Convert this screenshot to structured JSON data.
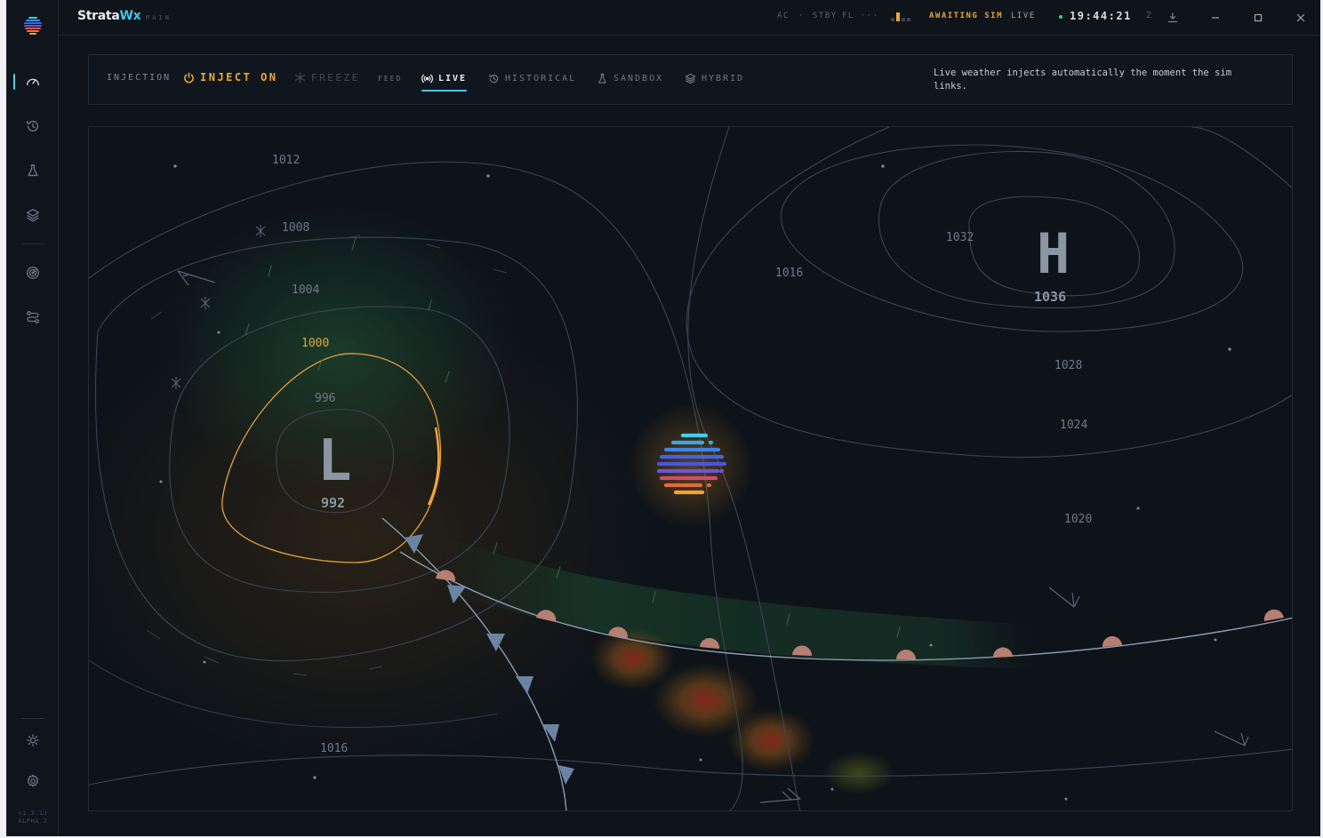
{
  "app": {
    "brand_main": "Strata",
    "brand_accent": "Wx",
    "brand_sub": "MAIN",
    "version_line1": "v1.3.13",
    "version_line2": "ALPHA.2"
  },
  "rail": {
    "items": [
      {
        "name": "dashboard",
        "icon": "gauge-icon",
        "active": true
      },
      {
        "name": "history",
        "icon": "history-icon",
        "active": false
      },
      {
        "name": "lab",
        "icon": "flask-icon",
        "active": false
      },
      {
        "name": "layers",
        "icon": "layers-icon",
        "active": false
      },
      {
        "name": "radar",
        "icon": "radar-icon",
        "active": false
      },
      {
        "name": "routes",
        "icon": "route-icon",
        "active": false
      },
      {
        "name": "theme",
        "icon": "sun-icon",
        "active": false
      },
      {
        "name": "settings",
        "icon": "gear-icon",
        "active": false
      }
    ]
  },
  "status": {
    "ac": "AC",
    "sep": "·",
    "stby": "STBY",
    "fl": "FL ···",
    "awaiting": "AWAITING SIM",
    "live": "LIVE",
    "clock": "19:44:21",
    "clock_suffix": "Z"
  },
  "controls": {
    "injection_label": "INJECTION",
    "inject_on": "INJECT ON",
    "freeze": "FREEZE",
    "feed_label": "FEED",
    "tabs": [
      {
        "label": "LIVE",
        "icon": "broadcast-icon",
        "active": true
      },
      {
        "label": "HISTORICAL",
        "icon": "history-icon",
        "active": false
      },
      {
        "label": "SANDBOX",
        "icon": "flask-icon",
        "active": false
      },
      {
        "label": "HYBRID",
        "icon": "layers-icon",
        "active": false
      }
    ],
    "description": "Live weather injects automatically the moment the sim links."
  },
  "map": {
    "isobars": {
      "p1012": "1012",
      "p1008": "1008",
      "p1004": "1004",
      "p1000": "1000",
      "p996": "996",
      "p992": "992",
      "p1016a": "1016",
      "p1016b": "1016",
      "p1032": "1032",
      "p1036": "1036",
      "p1028": "1028",
      "p1024": "1024",
      "p1020": "1020"
    },
    "low_label": "L",
    "high_label": "H"
  },
  "colors": {
    "accent": "#47c7e6",
    "warning": "#f0a63b",
    "background": "#0f141b"
  }
}
